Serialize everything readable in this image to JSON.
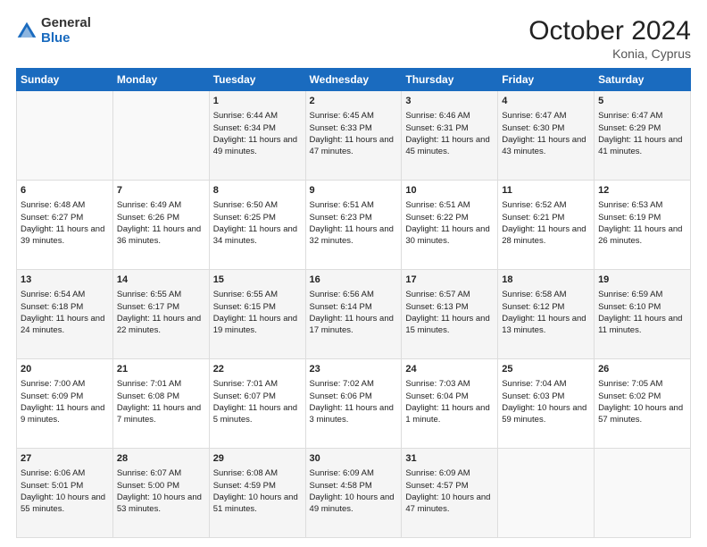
{
  "header": {
    "logo": {
      "general": "General",
      "blue": "Blue"
    },
    "title": "October 2024",
    "location": "Konia, Cyprus"
  },
  "weekdays": [
    "Sunday",
    "Monday",
    "Tuesday",
    "Wednesday",
    "Thursday",
    "Friday",
    "Saturday"
  ],
  "weeks": [
    [
      {
        "day": "",
        "sunrise": "",
        "sunset": "",
        "daylight": ""
      },
      {
        "day": "",
        "sunrise": "",
        "sunset": "",
        "daylight": ""
      },
      {
        "day": "1",
        "sunrise": "Sunrise: 6:44 AM",
        "sunset": "Sunset: 6:34 PM",
        "daylight": "Daylight: 11 hours and 49 minutes."
      },
      {
        "day": "2",
        "sunrise": "Sunrise: 6:45 AM",
        "sunset": "Sunset: 6:33 PM",
        "daylight": "Daylight: 11 hours and 47 minutes."
      },
      {
        "day": "3",
        "sunrise": "Sunrise: 6:46 AM",
        "sunset": "Sunset: 6:31 PM",
        "daylight": "Daylight: 11 hours and 45 minutes."
      },
      {
        "day": "4",
        "sunrise": "Sunrise: 6:47 AM",
        "sunset": "Sunset: 6:30 PM",
        "daylight": "Daylight: 11 hours and 43 minutes."
      },
      {
        "day": "5",
        "sunrise": "Sunrise: 6:47 AM",
        "sunset": "Sunset: 6:29 PM",
        "daylight": "Daylight: 11 hours and 41 minutes."
      }
    ],
    [
      {
        "day": "6",
        "sunrise": "Sunrise: 6:48 AM",
        "sunset": "Sunset: 6:27 PM",
        "daylight": "Daylight: 11 hours and 39 minutes."
      },
      {
        "day": "7",
        "sunrise": "Sunrise: 6:49 AM",
        "sunset": "Sunset: 6:26 PM",
        "daylight": "Daylight: 11 hours and 36 minutes."
      },
      {
        "day": "8",
        "sunrise": "Sunrise: 6:50 AM",
        "sunset": "Sunset: 6:25 PM",
        "daylight": "Daylight: 11 hours and 34 minutes."
      },
      {
        "day": "9",
        "sunrise": "Sunrise: 6:51 AM",
        "sunset": "Sunset: 6:23 PM",
        "daylight": "Daylight: 11 hours and 32 minutes."
      },
      {
        "day": "10",
        "sunrise": "Sunrise: 6:51 AM",
        "sunset": "Sunset: 6:22 PM",
        "daylight": "Daylight: 11 hours and 30 minutes."
      },
      {
        "day": "11",
        "sunrise": "Sunrise: 6:52 AM",
        "sunset": "Sunset: 6:21 PM",
        "daylight": "Daylight: 11 hours and 28 minutes."
      },
      {
        "day": "12",
        "sunrise": "Sunrise: 6:53 AM",
        "sunset": "Sunset: 6:19 PM",
        "daylight": "Daylight: 11 hours and 26 minutes."
      }
    ],
    [
      {
        "day": "13",
        "sunrise": "Sunrise: 6:54 AM",
        "sunset": "Sunset: 6:18 PM",
        "daylight": "Daylight: 11 hours and 24 minutes."
      },
      {
        "day": "14",
        "sunrise": "Sunrise: 6:55 AM",
        "sunset": "Sunset: 6:17 PM",
        "daylight": "Daylight: 11 hours and 22 minutes."
      },
      {
        "day": "15",
        "sunrise": "Sunrise: 6:55 AM",
        "sunset": "Sunset: 6:15 PM",
        "daylight": "Daylight: 11 hours and 19 minutes."
      },
      {
        "day": "16",
        "sunrise": "Sunrise: 6:56 AM",
        "sunset": "Sunset: 6:14 PM",
        "daylight": "Daylight: 11 hours and 17 minutes."
      },
      {
        "day": "17",
        "sunrise": "Sunrise: 6:57 AM",
        "sunset": "Sunset: 6:13 PM",
        "daylight": "Daylight: 11 hours and 15 minutes."
      },
      {
        "day": "18",
        "sunrise": "Sunrise: 6:58 AM",
        "sunset": "Sunset: 6:12 PM",
        "daylight": "Daylight: 11 hours and 13 minutes."
      },
      {
        "day": "19",
        "sunrise": "Sunrise: 6:59 AM",
        "sunset": "Sunset: 6:10 PM",
        "daylight": "Daylight: 11 hours and 11 minutes."
      }
    ],
    [
      {
        "day": "20",
        "sunrise": "Sunrise: 7:00 AM",
        "sunset": "Sunset: 6:09 PM",
        "daylight": "Daylight: 11 hours and 9 minutes."
      },
      {
        "day": "21",
        "sunrise": "Sunrise: 7:01 AM",
        "sunset": "Sunset: 6:08 PM",
        "daylight": "Daylight: 11 hours and 7 minutes."
      },
      {
        "day": "22",
        "sunrise": "Sunrise: 7:01 AM",
        "sunset": "Sunset: 6:07 PM",
        "daylight": "Daylight: 11 hours and 5 minutes."
      },
      {
        "day": "23",
        "sunrise": "Sunrise: 7:02 AM",
        "sunset": "Sunset: 6:06 PM",
        "daylight": "Daylight: 11 hours and 3 minutes."
      },
      {
        "day": "24",
        "sunrise": "Sunrise: 7:03 AM",
        "sunset": "Sunset: 6:04 PM",
        "daylight": "Daylight: 11 hours and 1 minute."
      },
      {
        "day": "25",
        "sunrise": "Sunrise: 7:04 AM",
        "sunset": "Sunset: 6:03 PM",
        "daylight": "Daylight: 10 hours and 59 minutes."
      },
      {
        "day": "26",
        "sunrise": "Sunrise: 7:05 AM",
        "sunset": "Sunset: 6:02 PM",
        "daylight": "Daylight: 10 hours and 57 minutes."
      }
    ],
    [
      {
        "day": "27",
        "sunrise": "Sunrise: 6:06 AM",
        "sunset": "Sunset: 5:01 PM",
        "daylight": "Daylight: 10 hours and 55 minutes."
      },
      {
        "day": "28",
        "sunrise": "Sunrise: 6:07 AM",
        "sunset": "Sunset: 5:00 PM",
        "daylight": "Daylight: 10 hours and 53 minutes."
      },
      {
        "day": "29",
        "sunrise": "Sunrise: 6:08 AM",
        "sunset": "Sunset: 4:59 PM",
        "daylight": "Daylight: 10 hours and 51 minutes."
      },
      {
        "day": "30",
        "sunrise": "Sunrise: 6:09 AM",
        "sunset": "Sunset: 4:58 PM",
        "daylight": "Daylight: 10 hours and 49 minutes."
      },
      {
        "day": "31",
        "sunrise": "Sunrise: 6:09 AM",
        "sunset": "Sunset: 4:57 PM",
        "daylight": "Daylight: 10 hours and 47 minutes."
      },
      {
        "day": "",
        "sunrise": "",
        "sunset": "",
        "daylight": ""
      },
      {
        "day": "",
        "sunrise": "",
        "sunset": "",
        "daylight": ""
      }
    ]
  ],
  "rowShades": [
    "shade",
    "white",
    "shade",
    "white",
    "shade"
  ]
}
